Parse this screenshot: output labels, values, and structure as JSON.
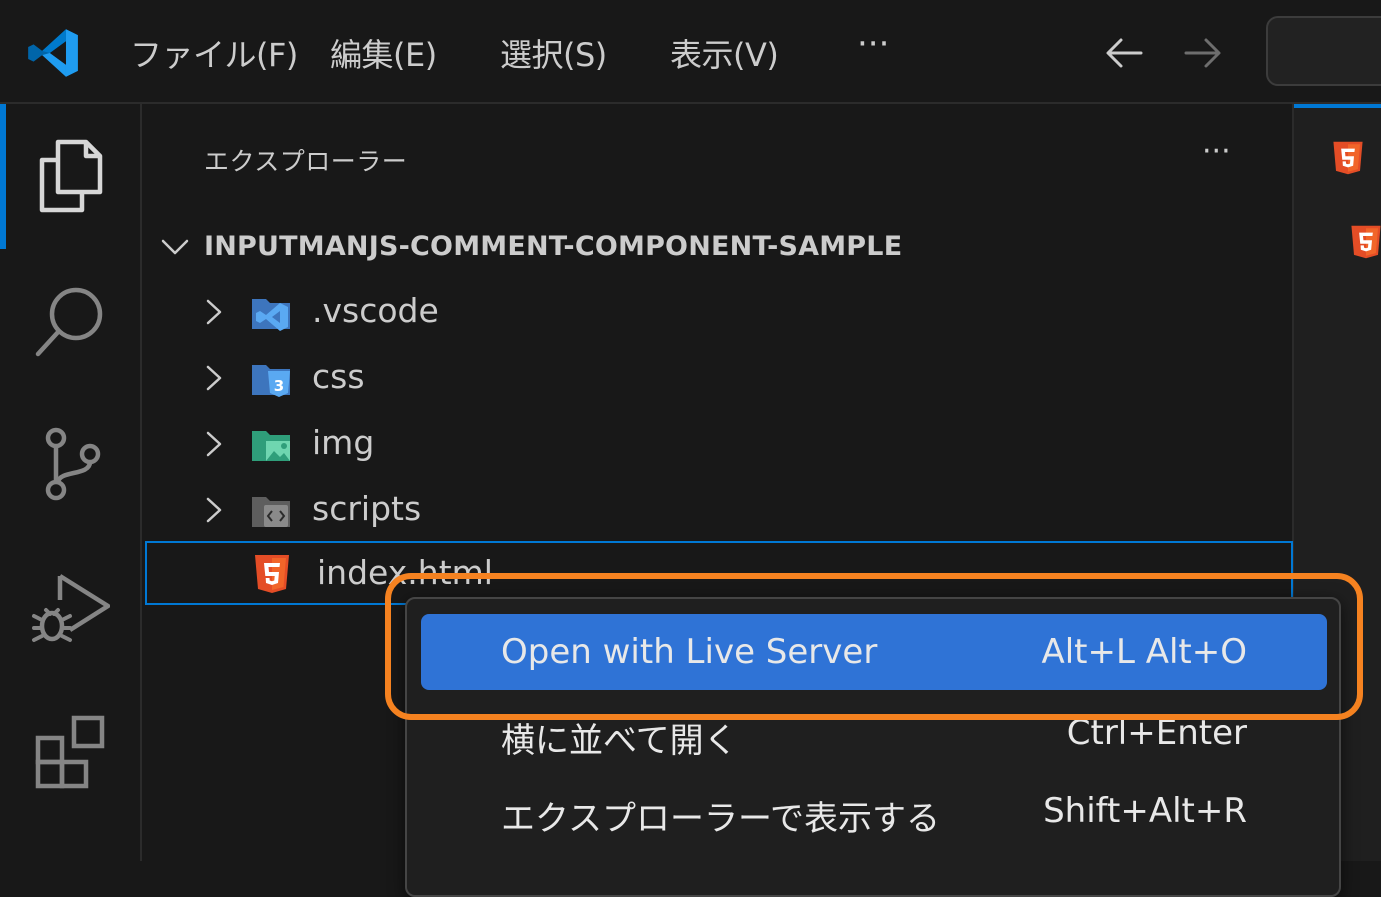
{
  "menubar": {
    "items": [
      {
        "label": "ファイル(F)"
      },
      {
        "label": "編集(E)"
      },
      {
        "label": "選択(S)"
      },
      {
        "label": "表示(V)"
      }
    ],
    "more": "···"
  },
  "sidebar": {
    "title": "エクスプローラー",
    "more": "···",
    "folder_name": "INPUTMANJS-COMMENT-COMPONENT-SAMPLE",
    "items": [
      {
        "label": ".vscode",
        "icon": "vscode-folder-icon"
      },
      {
        "label": "css",
        "icon": "css-folder-icon"
      },
      {
        "label": "img",
        "icon": "image-folder-icon"
      },
      {
        "label": "scripts",
        "icon": "scripts-folder-icon"
      },
      {
        "label": "index.html",
        "icon": "html5-file-icon"
      }
    ]
  },
  "context_menu": {
    "items": [
      {
        "label": "Open with Live Server",
        "shortcut": "Alt+L Alt+O"
      },
      {
        "label": "横に並べて開く",
        "shortcut": "Ctrl+Enter"
      },
      {
        "label": "エクスプローラーで表示する",
        "shortcut": "Shift+Alt+R"
      }
    ]
  },
  "colors": {
    "accent": "#0078d4",
    "menu_highlight": "#2f73d6",
    "callout": "#f58220",
    "html5": "#e44d26"
  }
}
